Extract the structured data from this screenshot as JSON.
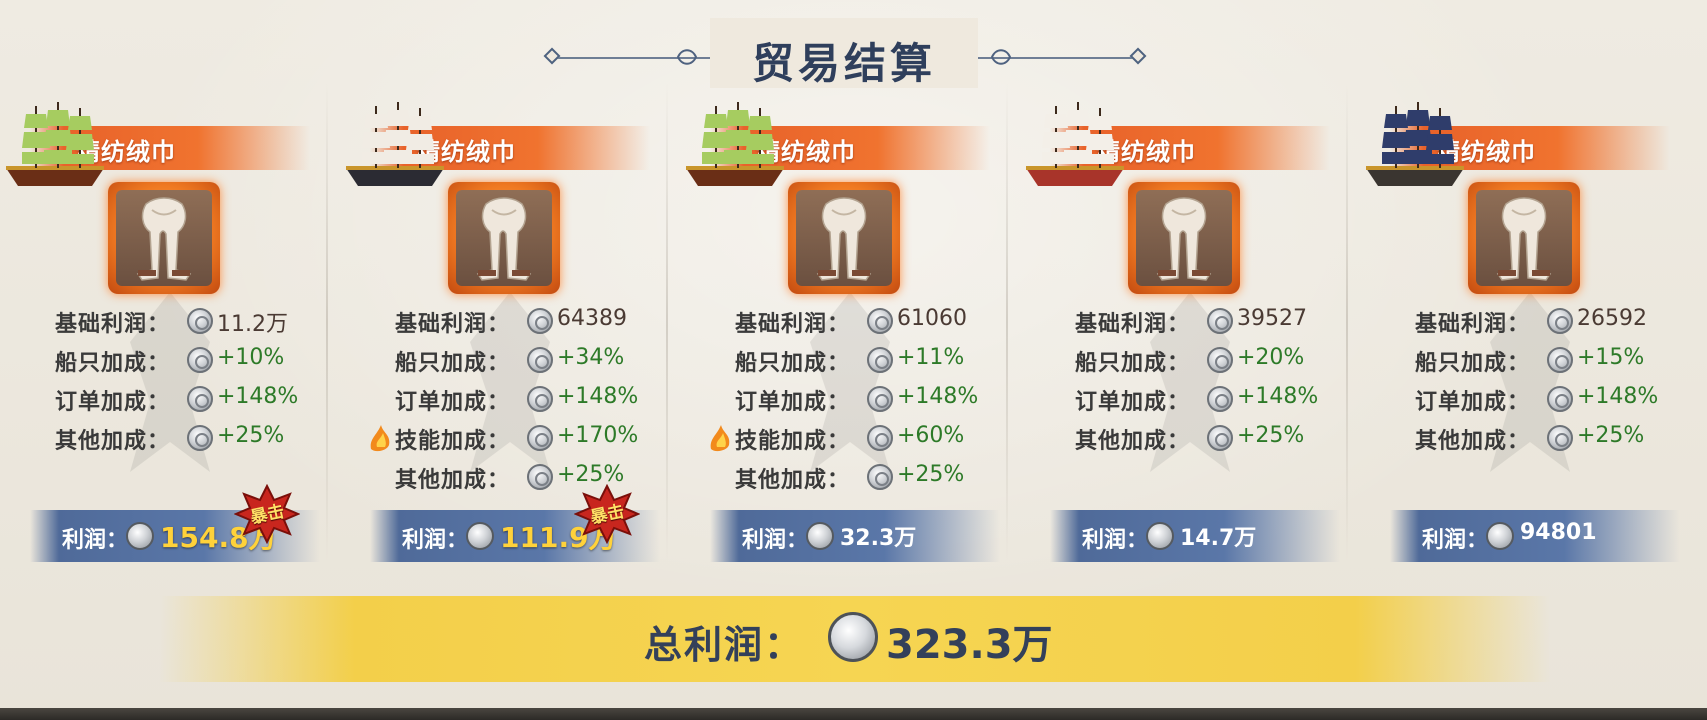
{
  "title": "贸易结算",
  "cards": [
    {
      "item_name": "精纺绒巾",
      "ship_icon": "green-sail-ship-icon",
      "rows": [
        {
          "label": "基础利润：",
          "value": "11.2万",
          "bonus": false,
          "flame": false
        },
        {
          "label": "船只加成：",
          "value": "+10%",
          "bonus": true,
          "flame": false
        },
        {
          "label": "订单加成：",
          "value": "+148%",
          "bonus": true,
          "flame": false
        },
        {
          "label": "其他加成：",
          "value": "+25%",
          "bonus": true,
          "flame": false
        }
      ],
      "profit_label": "利润：",
      "profit_value": "154.8万",
      "crit": true,
      "crit_text": "暴击"
    },
    {
      "item_name": "精纺绒巾",
      "ship_icon": "white-red-sail-ship-icon",
      "rows": [
        {
          "label": "基础利润：",
          "value": "64389",
          "bonus": false,
          "flame": false
        },
        {
          "label": "船只加成：",
          "value": "+34%",
          "bonus": true,
          "flame": false
        },
        {
          "label": "订单加成：",
          "value": "+148%",
          "bonus": true,
          "flame": false
        },
        {
          "label": "技能加成：",
          "value": "+170%",
          "bonus": true,
          "flame": true
        },
        {
          "label": "其他加成：",
          "value": "+25%",
          "bonus": true,
          "flame": false
        }
      ],
      "profit_label": "利润：",
      "profit_value": "111.9万",
      "crit": true,
      "crit_text": "暴击"
    },
    {
      "item_name": "精纺绒巾",
      "ship_icon": "green-sail-ship-icon",
      "rows": [
        {
          "label": "基础利润：",
          "value": "61060",
          "bonus": false,
          "flame": false
        },
        {
          "label": "船只加成：",
          "value": "+11%",
          "bonus": true,
          "flame": false
        },
        {
          "label": "订单加成：",
          "value": "+148%",
          "bonus": true,
          "flame": false
        },
        {
          "label": "技能加成：",
          "value": "+60%",
          "bonus": true,
          "flame": true
        },
        {
          "label": "其他加成：",
          "value": "+25%",
          "bonus": true,
          "flame": false
        }
      ],
      "profit_label": "利润：",
      "profit_value": "32.3万",
      "crit": false,
      "crit_text": ""
    },
    {
      "item_name": "精纺绒巾",
      "ship_icon": "cross-sail-ship-icon",
      "rows": [
        {
          "label": "基础利润：",
          "value": "39527",
          "bonus": false,
          "flame": false
        },
        {
          "label": "船只加成：",
          "value": "+20%",
          "bonus": true,
          "flame": false
        },
        {
          "label": "订单加成：",
          "value": "+148%",
          "bonus": true,
          "flame": false
        },
        {
          "label": "其他加成：",
          "value": "+25%",
          "bonus": true,
          "flame": false
        }
      ],
      "profit_label": "利润：",
      "profit_value": "14.7万",
      "crit": false,
      "crit_text": ""
    },
    {
      "item_name": "精纺绒巾",
      "ship_icon": "junk-ship-icon",
      "rows": [
        {
          "label": "基础利润：",
          "value": "26592",
          "bonus": false,
          "flame": false
        },
        {
          "label": "船只加成：",
          "value": "+15%",
          "bonus": true,
          "flame": false
        },
        {
          "label": "订单加成：",
          "value": "+148%",
          "bonus": true,
          "flame": false
        },
        {
          "label": "其他加成：",
          "value": "+25%",
          "bonus": true,
          "flame": false
        }
      ],
      "profit_label": "利润：",
      "profit_value": "94801",
      "crit": false,
      "crit_text": ""
    }
  ],
  "total": {
    "label": "总利润：",
    "value": "323.3万"
  },
  "colors": {
    "banner_orange": "#f0732f",
    "profit_blue": "#5a77a8",
    "total_gold": "#f6d552",
    "bonus_green": "#2d7a28",
    "title_navy": "#2f3f5c"
  },
  "icons": {
    "item": "scarf-icon",
    "coin": "silver-coin-icon",
    "flame": "flame-icon",
    "crit": "crit-burst-icon"
  }
}
